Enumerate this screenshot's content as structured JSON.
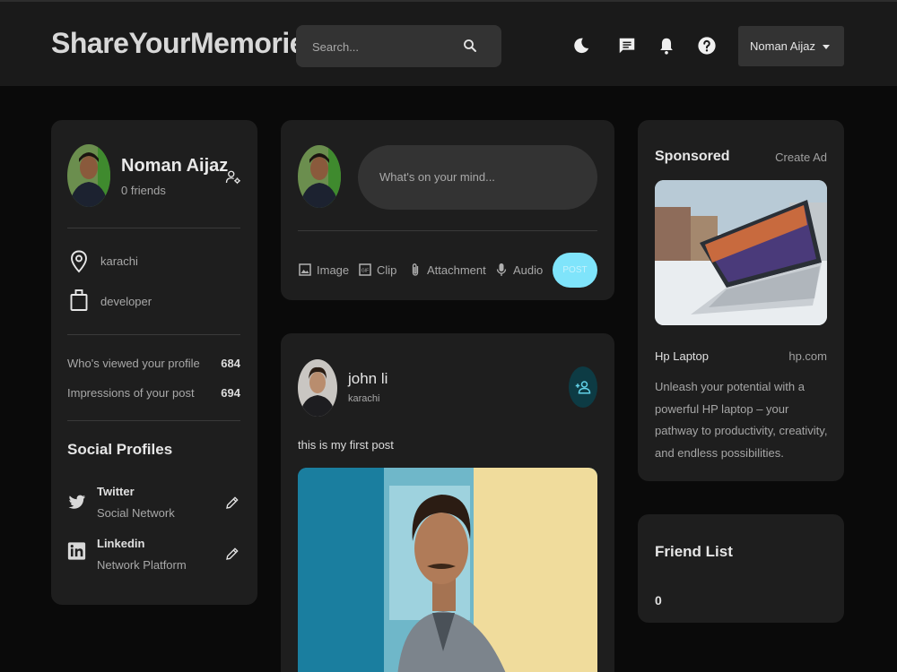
{
  "navbar": {
    "brand": "ShareYourMemories",
    "search_placeholder": "Search...",
    "icons": [
      "moon-icon",
      "message-icon",
      "bell-icon",
      "help-icon"
    ],
    "user_name": "Noman Aijaz"
  },
  "profile": {
    "name": "Noman Aijaz",
    "friends": "0 friends",
    "location": "karachi",
    "occupation": "developer",
    "stats": [
      {
        "label": "Who's viewed your profile",
        "value": "684"
      },
      {
        "label": "Impressions of your post",
        "value": "694"
      }
    ],
    "social_title": "Social Profiles",
    "socials": [
      {
        "name": "Twitter",
        "sub": "Social Network"
      },
      {
        "name": "Linkedin",
        "sub": "Network Platform"
      }
    ]
  },
  "composer": {
    "placeholder": "What's on your mind...",
    "tools": [
      {
        "label": "Image",
        "icon": "image-icon"
      },
      {
        "label": "Clip",
        "icon": "gif-icon"
      },
      {
        "label": "Attachment",
        "icon": "paperclip-icon"
      },
      {
        "label": "Audio",
        "icon": "microphone-icon"
      }
    ],
    "post_label": "POST"
  },
  "post": {
    "author": "john li",
    "location": "karachi",
    "text": "this is my first post"
  },
  "ad": {
    "title": "Sponsored",
    "create_label": "Create Ad",
    "product": "Hp Laptop",
    "domain": "hp.com",
    "description": "Unleash your potential with a powerful HP laptop – your pathway to productivity, creativity, and endless possibilities."
  },
  "friends": {
    "title": "Friend List",
    "count": "0"
  },
  "colors": {
    "background": "#0a0a0a",
    "card": "#1e1e1e",
    "navbar": "#1a1a1a",
    "post_button": "#7fe4fb",
    "add_friend_button": "#0d3b44"
  }
}
